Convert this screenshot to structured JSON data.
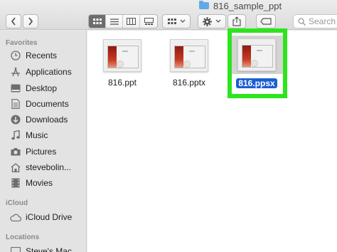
{
  "window": {
    "title": "816_sample_ppt"
  },
  "toolbar": {
    "back_label": "‹",
    "forward_label": "›",
    "search_placeholder": "Search",
    "view_modes": [
      "icon-view",
      "list-view",
      "column-view",
      "gallery-view"
    ],
    "active_view": "icon-view"
  },
  "sidebar": {
    "favorites_heading": "Favorites",
    "favorites": [
      {
        "label": "Recents",
        "icon": "clock-icon"
      },
      {
        "label": "Applications",
        "icon": "applications-icon"
      },
      {
        "label": "Desktop",
        "icon": "desktop-icon"
      },
      {
        "label": "Documents",
        "icon": "document-icon"
      },
      {
        "label": "Downloads",
        "icon": "download-icon"
      },
      {
        "label": "Music",
        "icon": "music-icon"
      },
      {
        "label": "Pictures",
        "icon": "camera-icon"
      },
      {
        "label": "stevebolin...",
        "icon": "home-icon"
      },
      {
        "label": "Movies",
        "icon": "film-icon"
      }
    ],
    "icloud_heading": "iCloud",
    "icloud": [
      {
        "label": "iCloud Drive",
        "icon": "cloud-icon"
      }
    ],
    "locations_heading": "Locations",
    "locations": [
      {
        "label": "Steve's Mac...",
        "icon": "computer-icon"
      }
    ]
  },
  "files": [
    {
      "name": "816.ppt",
      "selected": false
    },
    {
      "name": "816.pptx",
      "selected": false
    },
    {
      "name": "816.ppsx",
      "selected": true
    }
  ],
  "colors": {
    "highlight": "#2ce51c",
    "selection": "#1b5fd1",
    "folder": "#63a9e6"
  }
}
